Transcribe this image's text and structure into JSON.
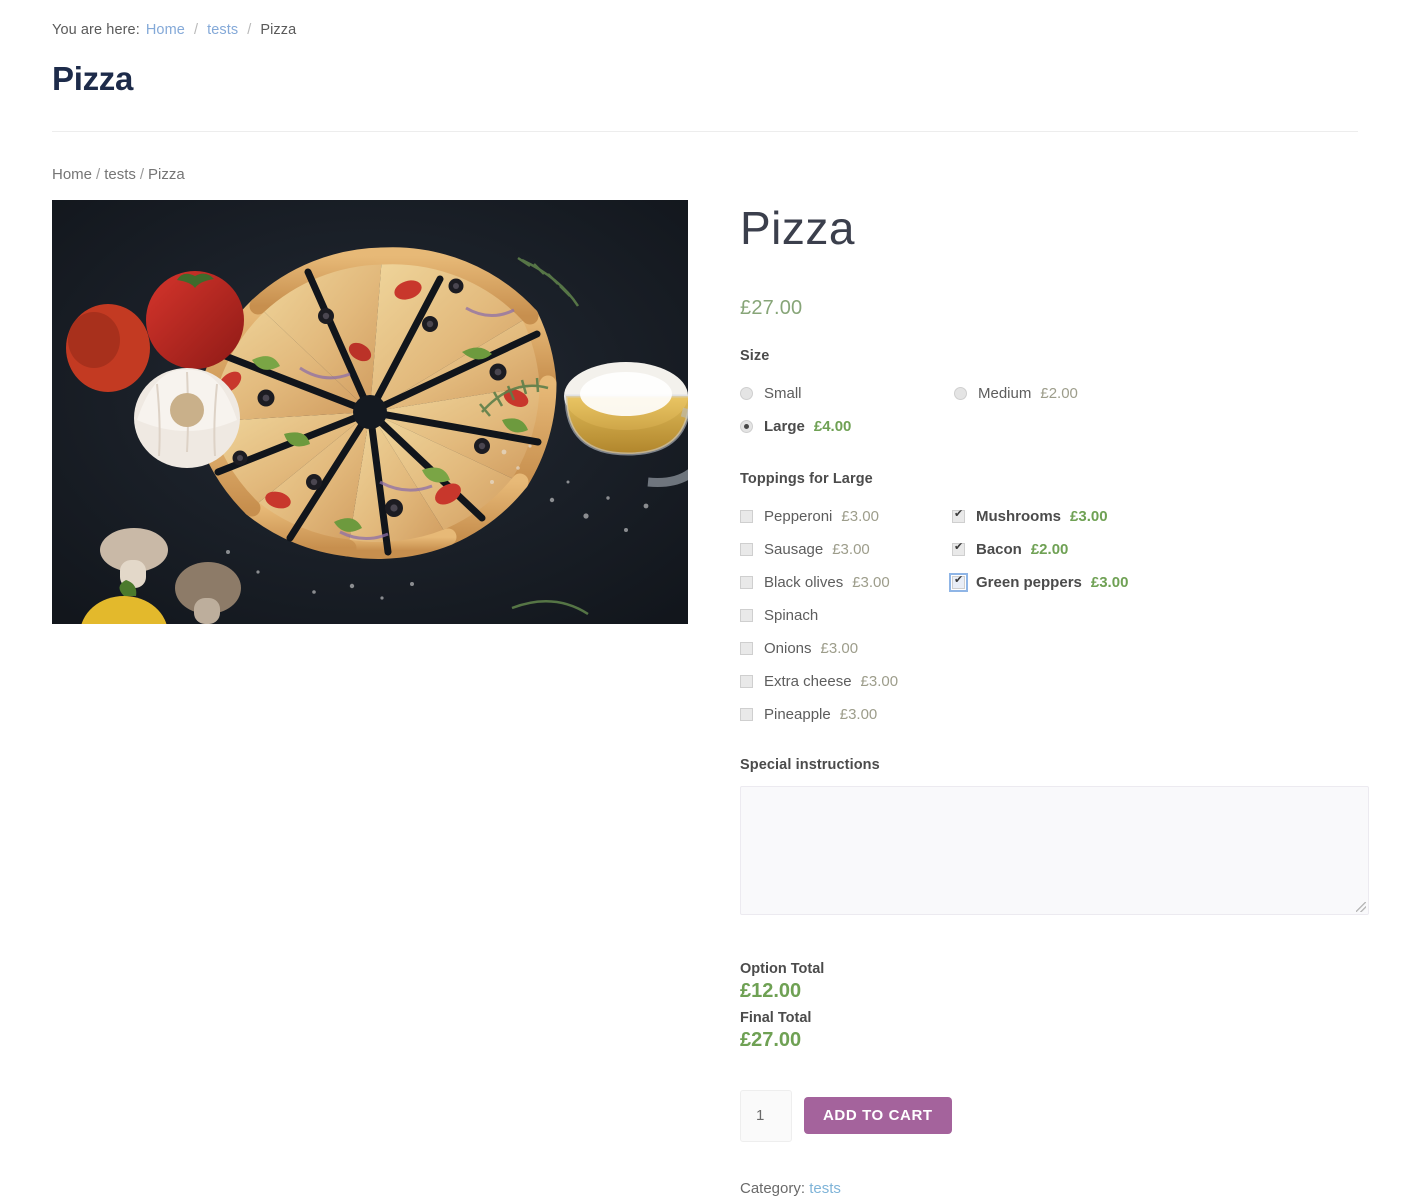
{
  "header": {
    "you_are_here_label": "You are here:",
    "crumbs": [
      {
        "text": "Home",
        "link": true
      },
      {
        "text": "tests",
        "link": true
      },
      {
        "text": "Pizza",
        "link": false
      }
    ],
    "separator": "/",
    "title": "Pizza"
  },
  "breadcrumb": {
    "home": "Home",
    "sep1": "/",
    "category": "tests",
    "sep2": "/",
    "current": "Pizza"
  },
  "gallery": {
    "image_alt": "pizza-photo"
  },
  "product": {
    "title": "Pizza",
    "price": "£27.00"
  },
  "size": {
    "label": "Size",
    "options": [
      {
        "name": "Small",
        "amount": "",
        "selected": false
      },
      {
        "name": "Medium",
        "amount": "£2.00",
        "selected": false
      },
      {
        "name": "Large",
        "amount": "£4.00",
        "selected": true
      }
    ]
  },
  "toppings": {
    "label": "Toppings for Large",
    "col1": [
      {
        "name": "Pepperoni",
        "amount": "£3.00",
        "checked": false,
        "focused": false
      },
      {
        "name": "Sausage",
        "amount": "£3.00",
        "checked": false,
        "focused": false
      },
      {
        "name": "Black olives",
        "amount": "£3.00",
        "checked": false,
        "focused": false
      },
      {
        "name": "Spinach",
        "amount": "",
        "checked": false,
        "focused": false
      }
    ],
    "col2": [
      {
        "name": "Mushrooms",
        "amount": "£3.00",
        "checked": true,
        "focused": false
      },
      {
        "name": "Bacon",
        "amount": "£2.00",
        "checked": true,
        "focused": false
      },
      {
        "name": "Green peppers",
        "amount": "£3.00",
        "checked": true,
        "focused": true
      }
    ],
    "col3": [
      {
        "name": "Onions",
        "amount": "£3.00",
        "checked": false,
        "focused": false
      },
      {
        "name": "Extra cheese",
        "amount": "£3.00",
        "checked": false,
        "focused": false
      },
      {
        "name": "Pineapple",
        "amount": "£3.00",
        "checked": false,
        "focused": false
      }
    ]
  },
  "special_instructions": {
    "label": "Special instructions",
    "value": "",
    "placeholder": ""
  },
  "totals": {
    "option_total_label": "Option Total",
    "option_total_value": "£12.00",
    "final_total_label": "Final Total",
    "final_total_value": "£27.00"
  },
  "cart": {
    "quantity": "1",
    "add_to_cart_label": "ADD TO CART"
  },
  "meta": {
    "category_label": "Category:",
    "category_value": "tests"
  },
  "colors": {
    "accent_purple": "#a4639c",
    "price_green": "#6fa154",
    "muted_price": "#9d9d8b",
    "link_blue": "#84a9d8",
    "title_navy": "#1d2b4a"
  }
}
